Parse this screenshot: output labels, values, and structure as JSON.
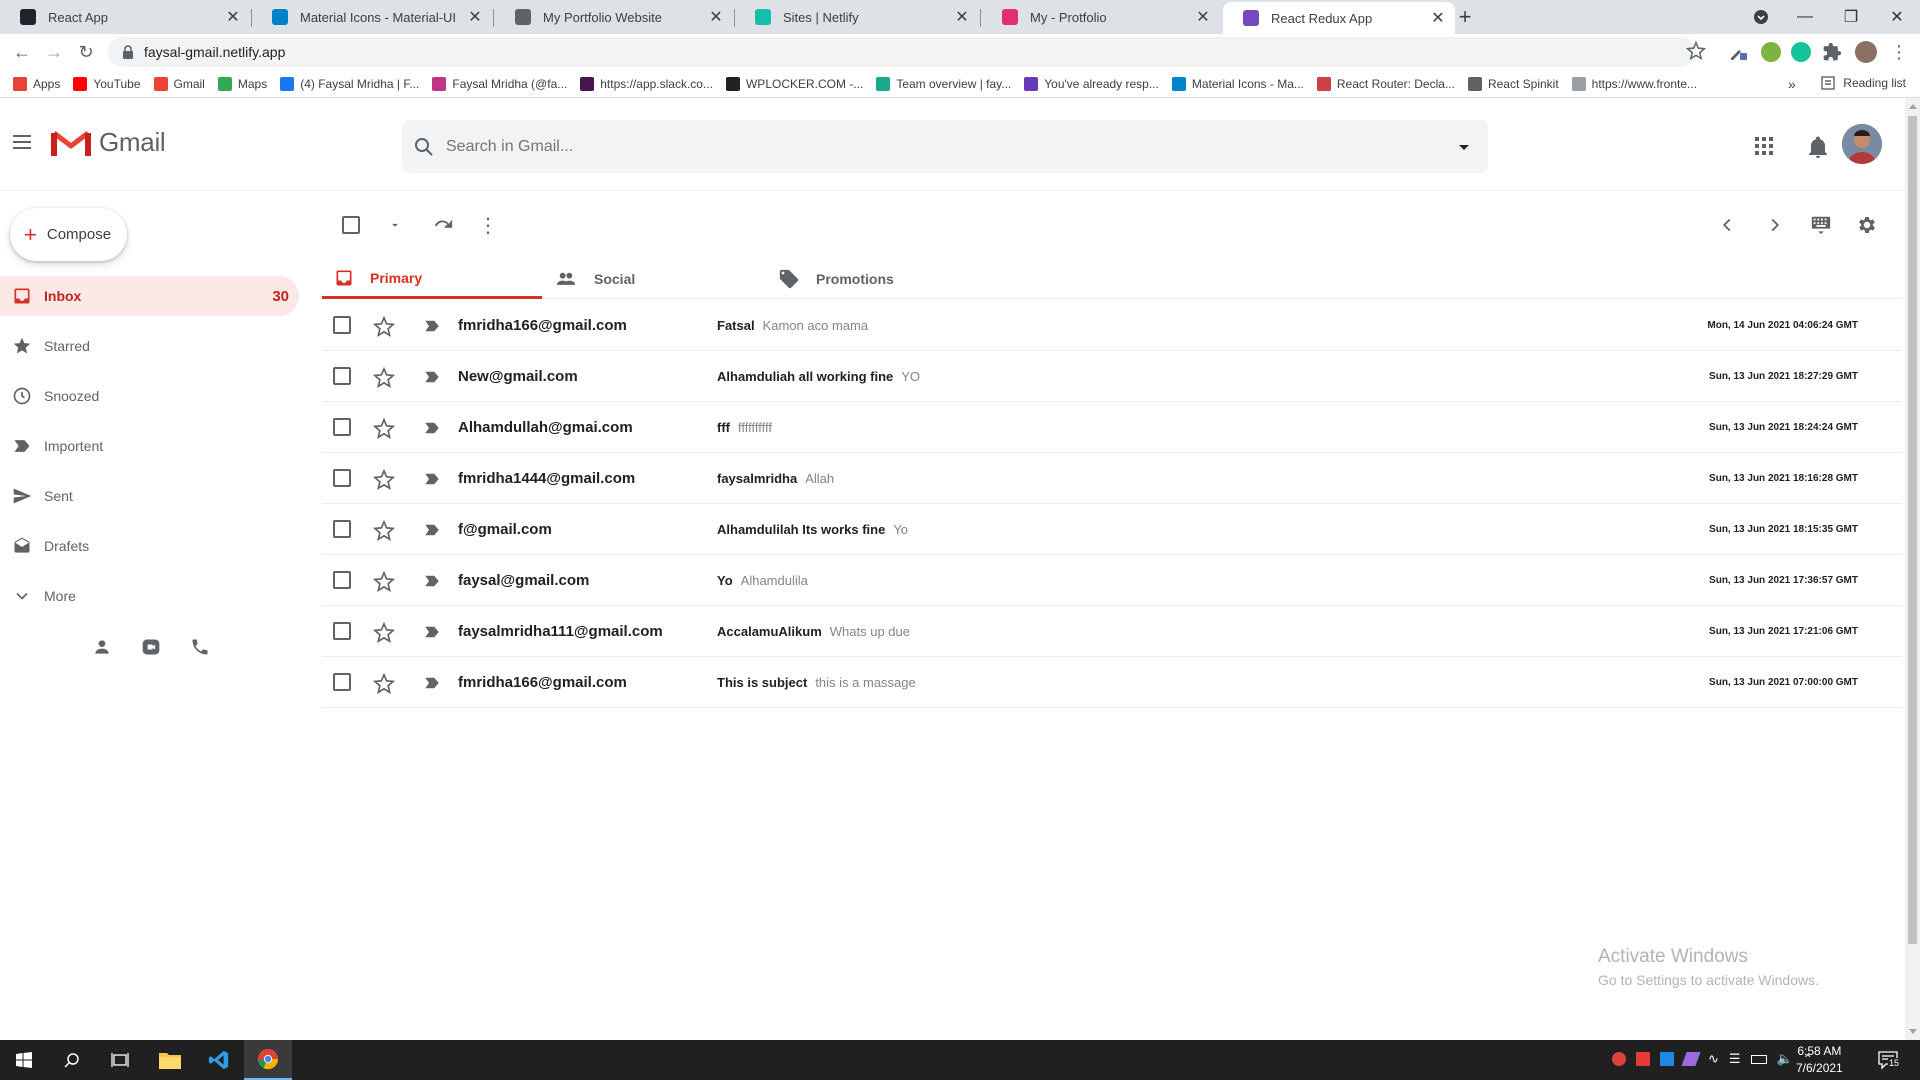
{
  "browser": {
    "tabs": [
      {
        "title": "React App",
        "icon": "react-favicon",
        "color": "#20232a"
      },
      {
        "title": "Material Icons - Material-UI",
        "icon": "mui-favicon",
        "color": "#0081cb"
      },
      {
        "title": "My Portfolio Website",
        "icon": "globe-favicon",
        "color": "#5f6368"
      },
      {
        "title": "Sites | Netlify",
        "icon": "netlify-favicon",
        "color": "#15bfab"
      },
      {
        "title": "My - Protfolio",
        "icon": "instagram-favicon",
        "color": "#e1306c"
      },
      {
        "title": "React Redux App",
        "icon": "redux-favicon",
        "color": "#764abc"
      }
    ],
    "url": "faysal-gmail.netlify.app",
    "bookmarks": [
      {
        "label": "Apps",
        "icon": "apps-grid-icon",
        "color": "#ea4335"
      },
      {
        "label": "YouTube",
        "icon": "youtube-icon",
        "color": "#ff0000"
      },
      {
        "label": "Gmail",
        "icon": "gmail-icon",
        "color": "#ea4335"
      },
      {
        "label": "Maps",
        "icon": "maps-icon",
        "color": "#34a853"
      },
      {
        "label": "(4) Faysal Mridha | F...",
        "icon": "facebook-icon",
        "color": "#1877f2"
      },
      {
        "label": "Faysal Mridha (@fa...",
        "icon": "instagram-icon",
        "color": "#c13584"
      },
      {
        "label": "https://app.slack.co...",
        "icon": "slack-icon",
        "color": "#4a154b"
      },
      {
        "label": "WPLOCKER.COM -...",
        "icon": "wplocker-icon",
        "color": "#222222"
      },
      {
        "label": "Team overview | fay...",
        "icon": "team-icon",
        "color": "#1aaa8c"
      },
      {
        "label": "You've already resp...",
        "icon": "forms-icon",
        "color": "#673ab7"
      },
      {
        "label": "Material Icons - Ma...",
        "icon": "mui-icon",
        "color": "#0081cb"
      },
      {
        "label": "React Router: Decla...",
        "icon": "react-router-icon",
        "color": "#ca4245"
      },
      {
        "label": "React Spinkit",
        "icon": "globe-icon",
        "color": "#5f6368"
      },
      {
        "label": "https://www.fronte...",
        "icon": "frontend-icon",
        "color": "#9aa0a6"
      }
    ],
    "overflow": "»",
    "reading_list": "Reading list"
  },
  "gmail": {
    "logo_text": "Gmail",
    "search_placeholder": "Search in Gmail...",
    "compose_label": "Compose",
    "sidebar": [
      {
        "label": "Inbox",
        "icon": "inbox-icon",
        "count": "30",
        "active": true
      },
      {
        "label": "Starred",
        "icon": "star-icon",
        "count": ""
      },
      {
        "label": "Snoozed",
        "icon": "clock-icon",
        "count": ""
      },
      {
        "label": "Importent",
        "icon": "label-important-icon",
        "count": ""
      },
      {
        "label": "Sent",
        "icon": "send-icon",
        "count": ""
      },
      {
        "label": "Drafets",
        "icon": "draft-icon",
        "count": ""
      },
      {
        "label": "More",
        "icon": "expand-more-icon",
        "count": ""
      }
    ],
    "inbox_tabs": [
      {
        "label": "Primary",
        "icon": "inbox-icon",
        "active": true
      },
      {
        "label": "Social",
        "icon": "people-icon"
      },
      {
        "label": "Promotions",
        "icon": "tag-icon"
      }
    ],
    "emails": [
      {
        "from": "fmridha166@gmail.com",
        "subject": "Fatsal",
        "description": "Kamon aco mama",
        "date": "Mon, 14 Jun 2021 04:06:24 GMT"
      },
      {
        "from": "New@gmail.com",
        "subject": "Alhamduliah all working fine",
        "description": "YO",
        "date": "Sun, 13 Jun 2021 18:27:29 GMT"
      },
      {
        "from": "Alhamdullah@gmai.com",
        "subject": "fff",
        "description": "ffffffffff",
        "date": "Sun, 13 Jun 2021 18:24:24 GMT"
      },
      {
        "from": "fmridha1444@gmail.com",
        "subject": "faysalmridha",
        "description": "Allah",
        "date": "Sun, 13 Jun 2021 18:16:28 GMT"
      },
      {
        "from": "f@gmail.com",
        "subject": "Alhamdulilah Its works fine",
        "description": "Yo",
        "date": "Sun, 13 Jun 2021 18:15:35 GMT"
      },
      {
        "from": "faysal@gmail.com",
        "subject": "Yo",
        "description": "Alhamdulila",
        "date": "Sun, 13 Jun 2021 17:36:57 GMT"
      },
      {
        "from": "faysalmridha111@gmail.com",
        "subject": "AccalamuAlikum",
        "description": "Whats up due",
        "date": "Sun, 13 Jun 2021 17:21:06 GMT"
      },
      {
        "from": "fmridha166@gmail.com",
        "subject": "This is subject",
        "description": "this is a massage",
        "date": "Sun, 13 Jun 2021 07:00:00 GMT"
      }
    ],
    "accent_color": "#d93025"
  },
  "watermark": {
    "line1": "Activate Windows",
    "line2": "Go to Settings to activate Windows."
  },
  "taskbar": {
    "time": "6:58 AM",
    "date": "7/6/2021",
    "notifications": "15"
  }
}
